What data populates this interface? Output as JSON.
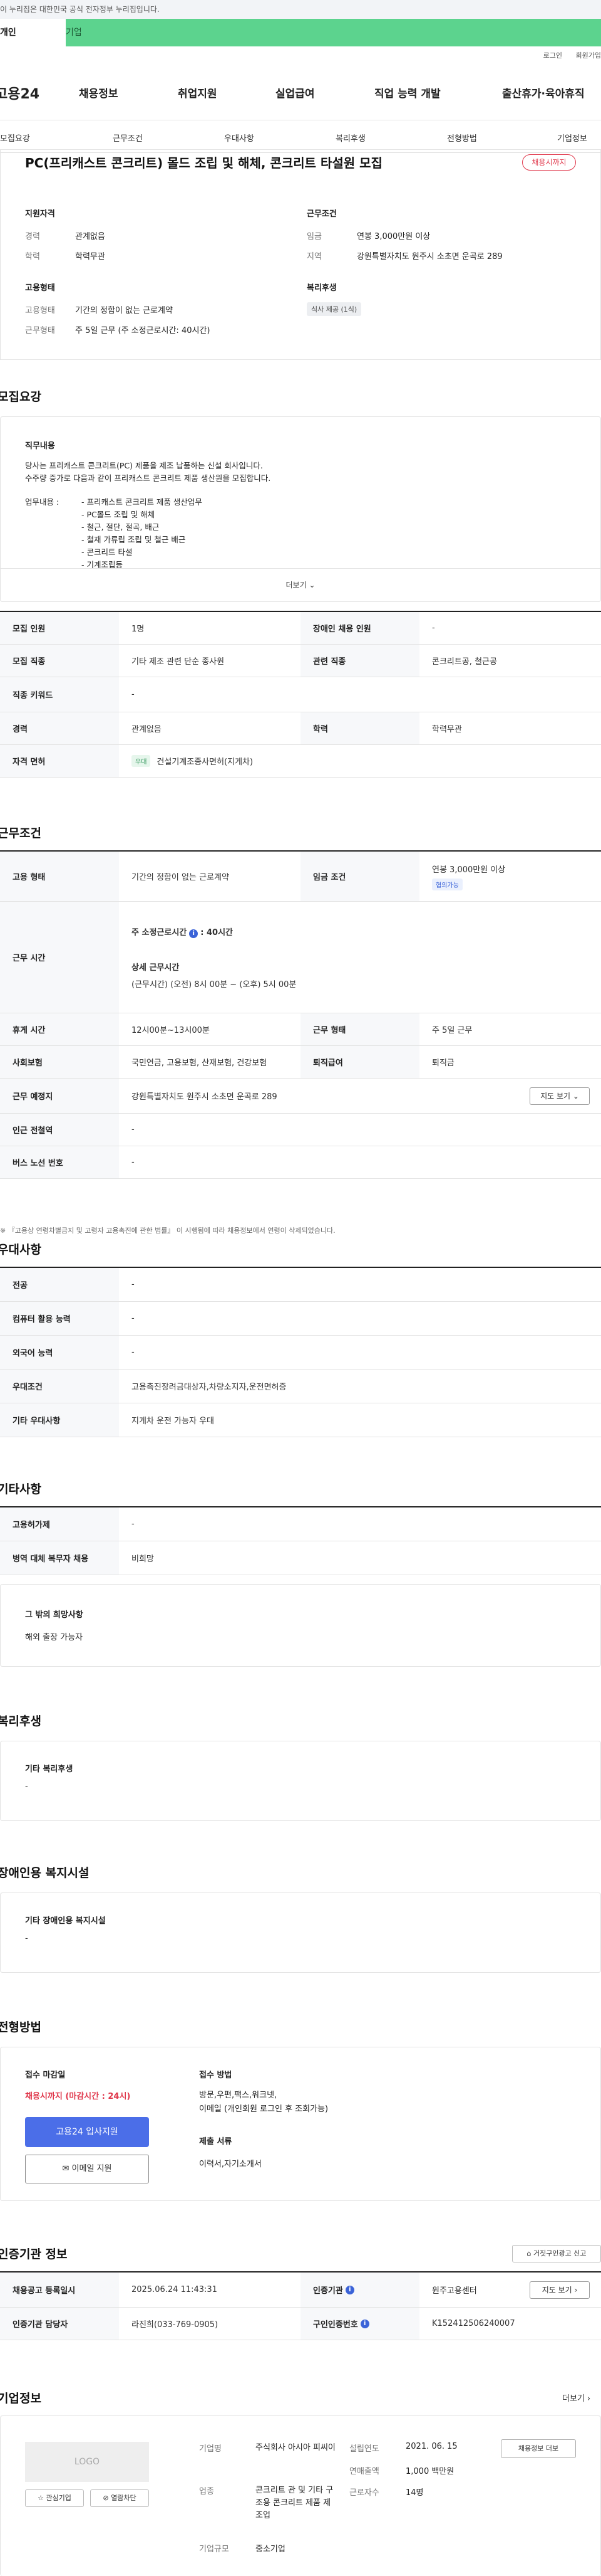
{
  "gov_banner": "이 누리집은 대한민국 공식 전자정부 누리집입니다.",
  "top_tabs": {
    "personal": "개인",
    "company": "기업"
  },
  "util": {
    "login": "로그인",
    "join": "회원가입"
  },
  "logo": "고용24",
  "gnb": [
    "채용정보",
    "취업지원",
    "실업급여",
    "직업 능력 개발",
    "출산휴가·육아휴직"
  ],
  "subnav": [
    "모집요강",
    "근무조건",
    "우대사항",
    "복리후생",
    "전형방법",
    "기업정보"
  ],
  "job": {
    "title": "PC(프리캐스트 콘크리트) 몰드 조립 및 해체, 콘크리트 타설원 모집",
    "status": "채용시까지"
  },
  "summary": {
    "qual_title": "지원자격",
    "career_label": "경력",
    "career": "관계없음",
    "edu_label": "학력",
    "edu": "학력무관",
    "cond_title": "근무조건",
    "wage_label": "임금",
    "wage": "연봉 3,000만원 이상",
    "region_label": "지역",
    "region": "강원특별자치도 원주시 소초면 운곡로 289",
    "emp_title": "고용형태",
    "emptype_label": "고용형태",
    "emptype": "기간의 정함이 없는 근로계약",
    "workform_label": "근무형태",
    "workform": "주 5일 근무 (주 소정근로시간: 40시간)",
    "welfare_title": "복리후생",
    "welfare_chip": "식사 제공 (1식)"
  },
  "recruit": {
    "heading": "모집요강",
    "duty_title": "직무내용",
    "duty_lines": [
      "당사는 프리캐스트 콘크리트(PC) 제품을 제조 납품하는 신설 회사입니다.",
      "수주량 증가로 다음과 같이 프리캐스트 콘크리트 제품 생산원을 모집합니다."
    ],
    "duty_label": "업무내용 :",
    "duty_items": [
      "- 프리캐스트 콘크리트 제품 생산업무",
      "- PC몰드 조립 및 해체",
      "- 철근, 절단, 절곡, 배근",
      "- 철재 가류립 조립 및 철근 배근",
      "- 콘크리트 타설",
      "- 기계조립등"
    ],
    "more": "더보기"
  },
  "recruit_table": {
    "count_label": "모집 인원",
    "count": "1명",
    "disabled_label": "장애인 채용 인원",
    "disabled": "-",
    "job_label": "모집 직종",
    "job": "기타 제조 관련 단순 종사원",
    "related_label": "관련 직종",
    "related": "콘크리트공, 철근공",
    "kw_label": "직종 키워드",
    "kw": "-",
    "career_label": "경력",
    "career": "관계없음",
    "edu_label": "학력",
    "edu": "학력무관",
    "license_label": "자격 면허",
    "license_tag": "우대",
    "license": "건설기계조종사면허(지게차)"
  },
  "work": {
    "heading": "근무조건",
    "emp_label": "고용 형태",
    "emp": "기간의 정함이 없는 근로계약",
    "wage_label": "임금 조건",
    "wage": "연봉 3,000만원 이상",
    "wage_tag": "협의가능",
    "hours_label": "근무 시간",
    "hours_week": "주 소정근로시간",
    "hours_value": ": 40시간",
    "hours_detail_title": "상세 근무시간",
    "hours_detail": "(근무시간) (오전) 8시 00분 ~ (오후) 5시 00분",
    "rest_label": "휴게 시간",
    "rest": "12시00분~13시00분",
    "form_label": "근무 형태",
    "form": "주 5일 근무",
    "insurance_label": "사회보험",
    "insurance": "국민연금, 고용보험, 산재보험, 건강보험",
    "retire_label": "퇴직급여",
    "retire": "퇴직금",
    "place_label": "근무 예정지",
    "place": "강원특별자치도 원주시 소초면 운곡로 289",
    "map_btn": "지도 보기",
    "subway_label": "인근 전철역",
    "subway": "-",
    "bus_label": "버스 노선 번호",
    "bus": "-",
    "note": "※ 『고용상 연령차별금지 및 고령자 고용촉진에 관한 법률』 이 시행됨에 따라 채용정보에서 연령이 삭제되었습니다."
  },
  "pref": {
    "heading": "우대사항",
    "major_label": "전공",
    "major": "-",
    "pc_label": "컴퓨터 활용 능력",
    "pc": "-",
    "lang_label": "외국어 능력",
    "lang": "-",
    "cond_label": "우대조건",
    "cond": "고용촉진장려금대상자,차량소지자,운전면허증",
    "etc_label": "기타 우대사항",
    "etc": "지게차 운전 가능자 우대"
  },
  "etc": {
    "heading": "기타사항",
    "meal_label": "고용허가제",
    "meal": "-",
    "army_label": "병역 대체 복무자 채용",
    "army": "비희망",
    "other_title": "그 밖의 희망사항",
    "other": "해외 출장 가능자"
  },
  "welfare": {
    "heading": "복리후생",
    "title": "기타 복리후생",
    "value": "-"
  },
  "disability": {
    "heading": "장애인용 복지시설",
    "title": "기타 장애인용 복지시설",
    "value": "-"
  },
  "selection": {
    "heading": "전형방법",
    "deadline_title": "접수 마감일",
    "deadline": "채용시까지 (마감시간 : 24시)",
    "apply_btn": "고용24 입사지원",
    "email_btn": "이메일 지원",
    "method_title": "접수 방법",
    "method": "방문,우편,팩스,워크넷,",
    "method2": "이메일 (개인회원 로그인 후 조회가능)",
    "docs_title": "제출 서류",
    "docs": "이력서,자기소개서"
  },
  "cert": {
    "heading": "인증기관 정보",
    "report_btn": "거짓구인광고 신고",
    "reg_label": "채용공고 등록일시",
    "reg": "2025.06.24 11:43:31",
    "agency_label": "인증기관",
    "agency": "원주고용센터",
    "map_btn": "지도 보기",
    "manager_label": "인증기관 담당자",
    "manager": "라진희(033-769-0905)",
    "id_label": "구인인증번호",
    "id": "K152412506240007"
  },
  "company": {
    "heading": "기업정보",
    "more": "더보기",
    "logo": "LOGO",
    "fav_btn": "관심기업",
    "block_btn": "열람차단",
    "name_label": "기업명",
    "name": "주식회사 아시아 피씨이",
    "industry_label": "업종",
    "industry": "콘크리트 관 및 기타 구조용 콘크리트 제품 제조업",
    "size_label": "기업규모",
    "size": "중소기업",
    "founded_label": "설립연도",
    "founded": "2021. 06. 15",
    "sales_label": "연매출액",
    "sales": "1,000 백만원",
    "emp_label": "근로자수",
    "emp": "14명",
    "jobs_btn": "채용정보 더보"
  }
}
